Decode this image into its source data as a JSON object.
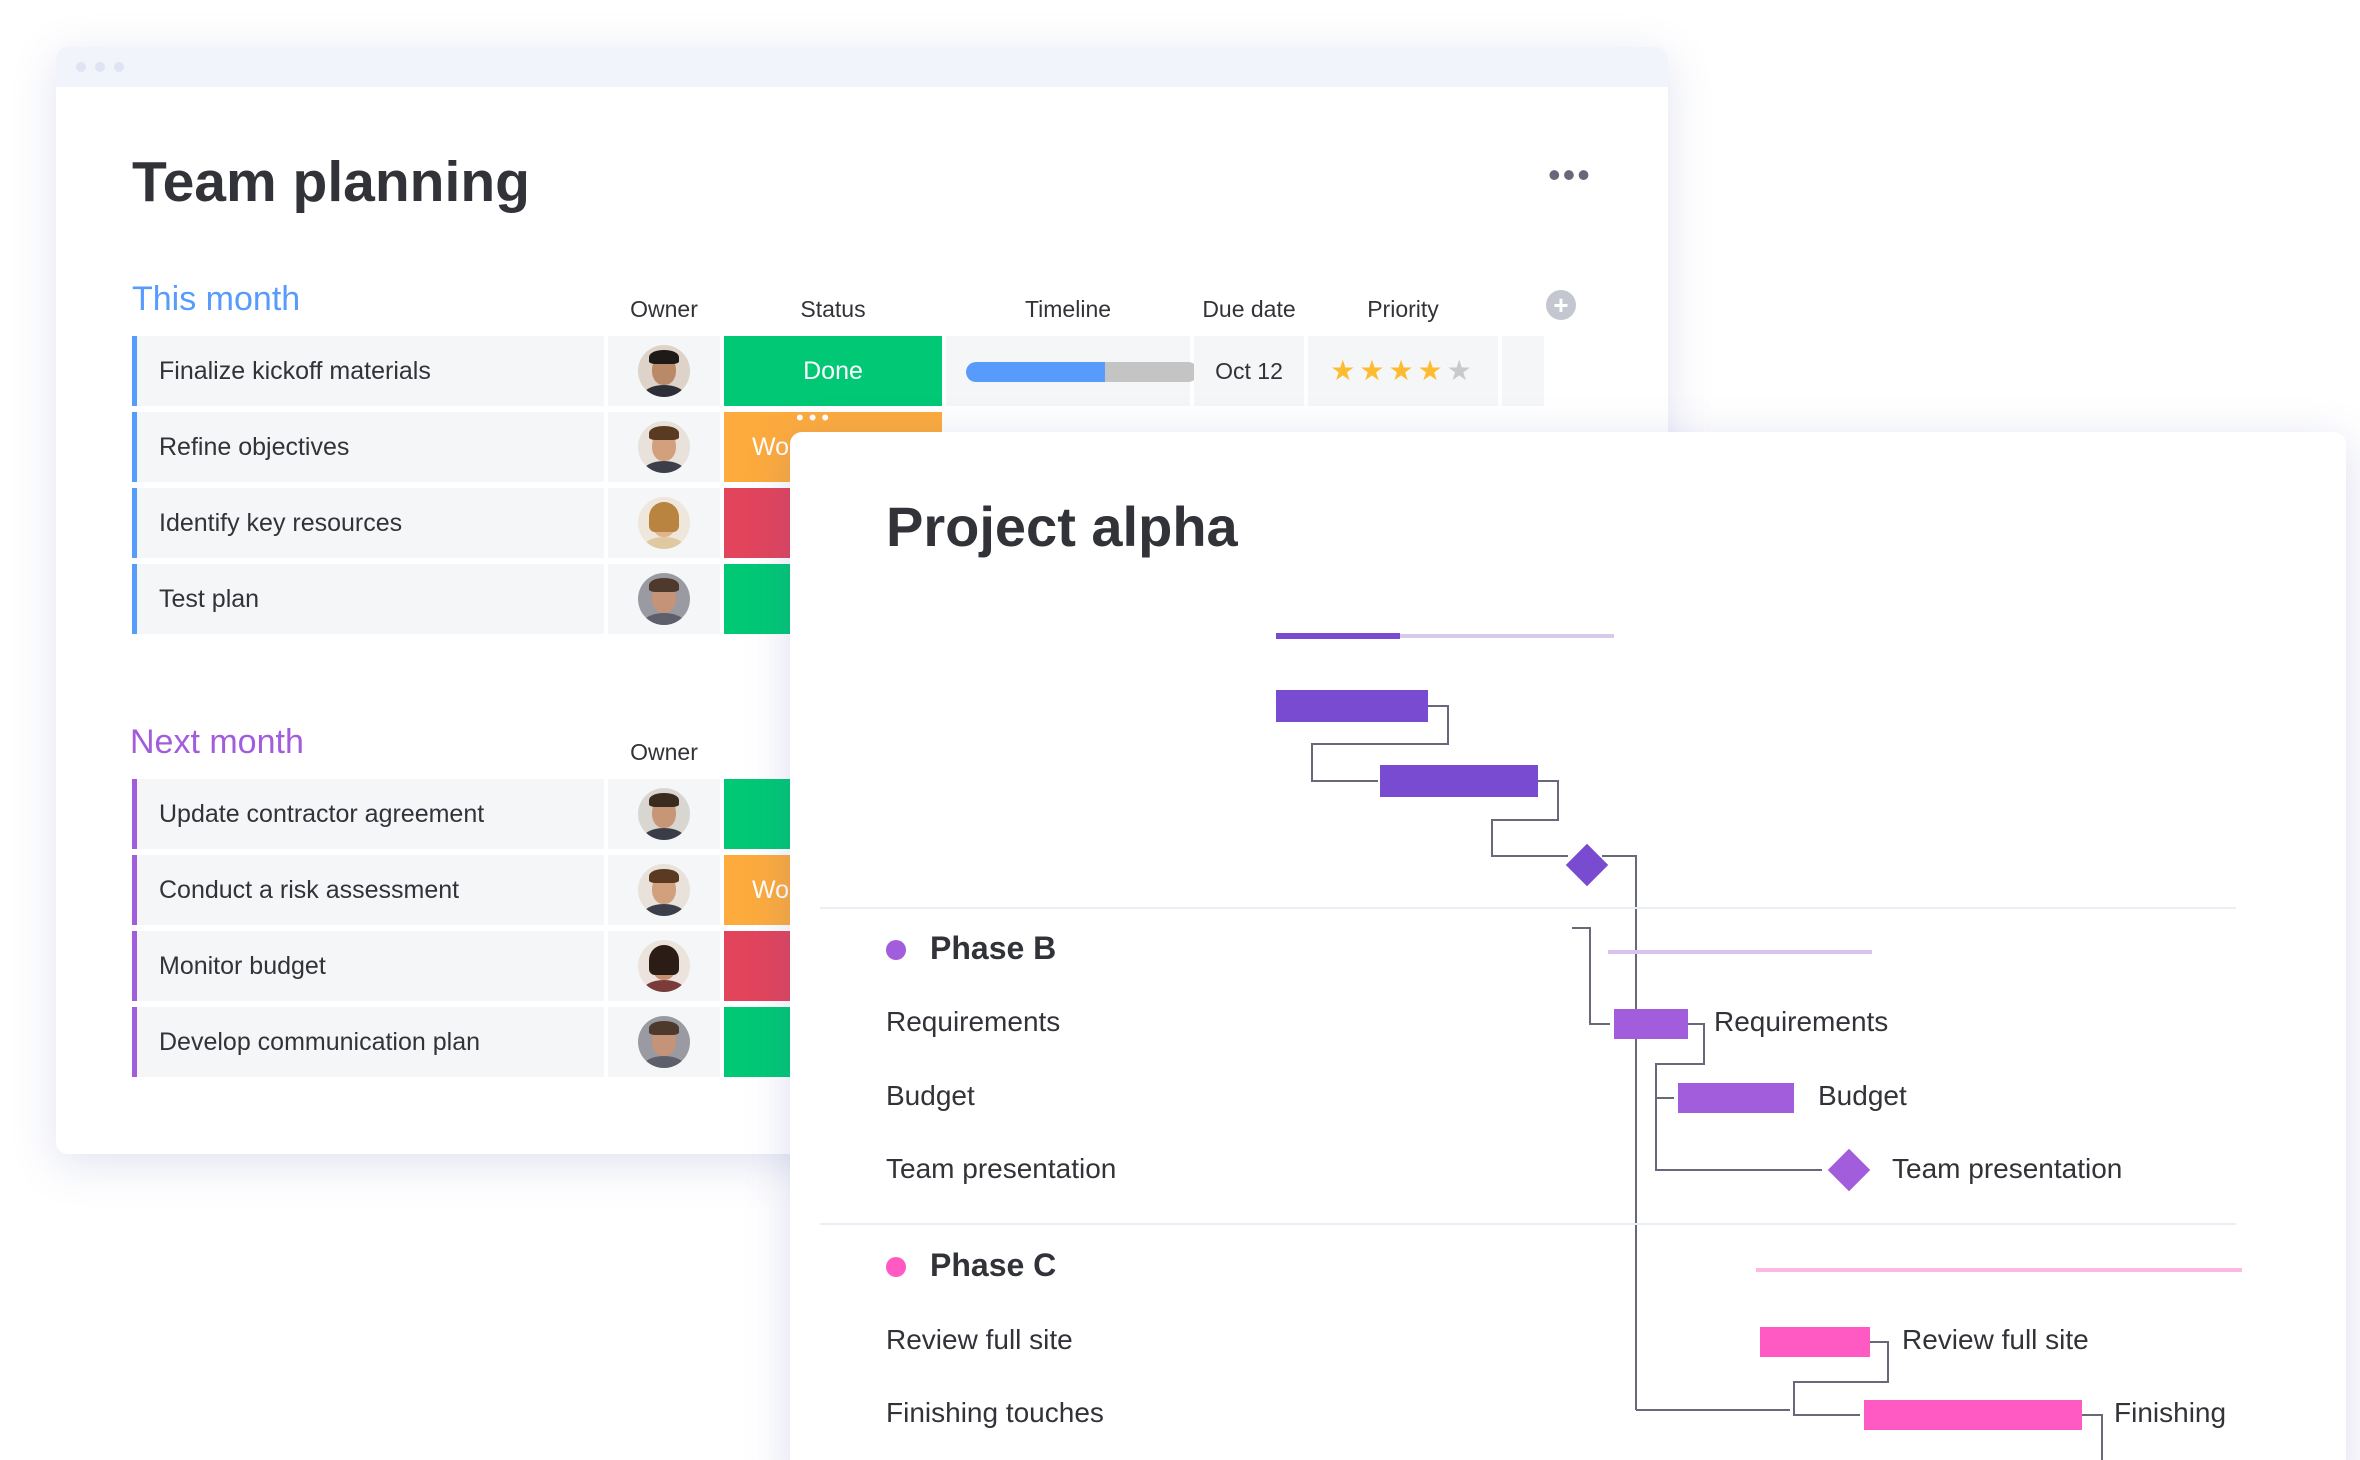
{
  "team_planning": {
    "title": "Team planning",
    "menu_icon": "more-horizontal-icon",
    "add_column_icon": "plus-circle-icon",
    "add_column_symbol": "+",
    "status_overflow": "•••",
    "columns": {
      "owner": "Owner",
      "status": "Status",
      "timeline": "Timeline",
      "due_date": "Due date",
      "priority": "Priority"
    },
    "groups": [
      {
        "title": "This month",
        "color": "#579bfc",
        "rows": [
          {
            "name": "Finalize kickoff materials",
            "status": "Done",
            "status_color": "#00c875",
            "timeline_progress": 0.6,
            "due": "Oct 12",
            "priority": 4,
            "priority_max": 5
          },
          {
            "name": "Refine objectives",
            "status": "Wo",
            "status_color": "#fdab3d"
          },
          {
            "name": "Identify key resources",
            "status": "",
            "status_color": "#e2445c"
          },
          {
            "name": "Test plan",
            "status": "",
            "status_color": "#00c875"
          }
        ]
      },
      {
        "title": "Next month",
        "color": "#a25ddc",
        "owner_header": "Owner",
        "rows": [
          {
            "name": "Update contractor agreement",
            "status": "",
            "status_color": "#00c875"
          },
          {
            "name": "Conduct a risk assessment",
            "status": "Wo",
            "status_color": "#fdab3d"
          },
          {
            "name": "Monitor budget",
            "status": "",
            "status_color": "#e2445c"
          },
          {
            "name": "Develop communication plan",
            "status": "",
            "status_color": "#00c875"
          }
        ]
      }
    ]
  },
  "project_alpha": {
    "title": "Project alpha",
    "phases": [
      {
        "title": "Phase B",
        "color": "#a25ddc",
        "tasks": [
          "Requirements",
          "Budget",
          "Team presentation"
        ],
        "bar_labels": [
          "Requirements",
          "Budget",
          "Team presentation"
        ]
      },
      {
        "title": "Phase C",
        "color": "#ff5ac4",
        "tasks": [
          "Review full site",
          "Finishing touches"
        ],
        "bar_labels": [
          "Review full site",
          "Finishing"
        ]
      }
    ],
    "colors": {
      "phase_a": "#784bd1",
      "phase_b": "#a25ddc",
      "phase_c": "#ff5ac4",
      "connector": "#676879"
    }
  }
}
